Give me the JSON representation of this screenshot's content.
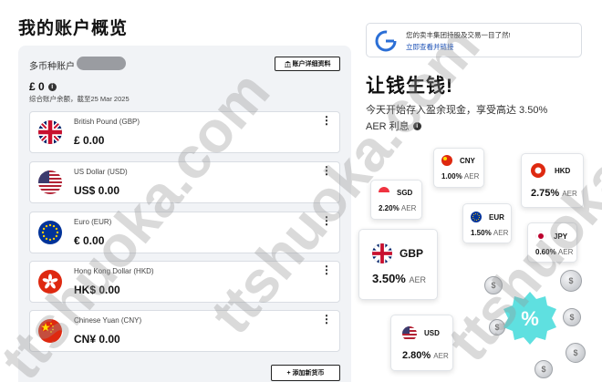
{
  "page": {
    "title": "我的账户概览"
  },
  "overview": {
    "multi_currency_label": "多币种账户",
    "details_button": "账户详细资料",
    "total_balance": "£ 0",
    "balance_note": "综合账户余额，截至25 Mar 2025",
    "add_currency_button": "+ 添加新货币"
  },
  "accounts": [
    {
      "name": "British Pound (GBP)",
      "balance": "£ 0.00",
      "flag": "uk-flag-icon"
    },
    {
      "name": "US Dollar (USD)",
      "balance": "US$ 0.00",
      "flag": "us-flag-icon"
    },
    {
      "name": "Euro (EUR)",
      "balance": "€ 0.00",
      "flag": "eu-flag-icon"
    },
    {
      "name": "Hong Kong Dollar (HKD)",
      "balance": "HK$ 0.00",
      "flag": "hk-flag-icon"
    },
    {
      "name": "Chinese Yuan (CNY)",
      "balance": "CN¥ 0.00",
      "flag": "cn-flag-icon"
    }
  ],
  "banner": {
    "text": "您的卖丰集团持股及交易一目了然!",
    "link": "立即查看并链接"
  },
  "promo": {
    "title": "让钱生钱!",
    "line1": "今天开始存入盈余现金，享受高达 3.50%",
    "line2": "AER 利息"
  },
  "rate_chips": [
    {
      "code": "SGD",
      "rate": "2.20%",
      "suffix": "AER"
    },
    {
      "code": "CNY",
      "rate": "1.00%",
      "suffix": "AER"
    },
    {
      "code": "HKD",
      "rate": "2.75%",
      "suffix": "AER"
    },
    {
      "code": "EUR",
      "rate": "1.50%",
      "suffix": "AER"
    },
    {
      "code": "JPY",
      "rate": "0.60%",
      "suffix": "AER"
    },
    {
      "code": "GBP",
      "rate": "3.50%",
      "suffix": "AER"
    },
    {
      "code": "USD",
      "rate": "2.80%",
      "suffix": "AER"
    }
  ],
  "watermark": "ttshuoka.com",
  "colors": {
    "link": "#1a4fb5",
    "panel_bg": "#f1f3f6",
    "badge": "#5fe0e0"
  }
}
